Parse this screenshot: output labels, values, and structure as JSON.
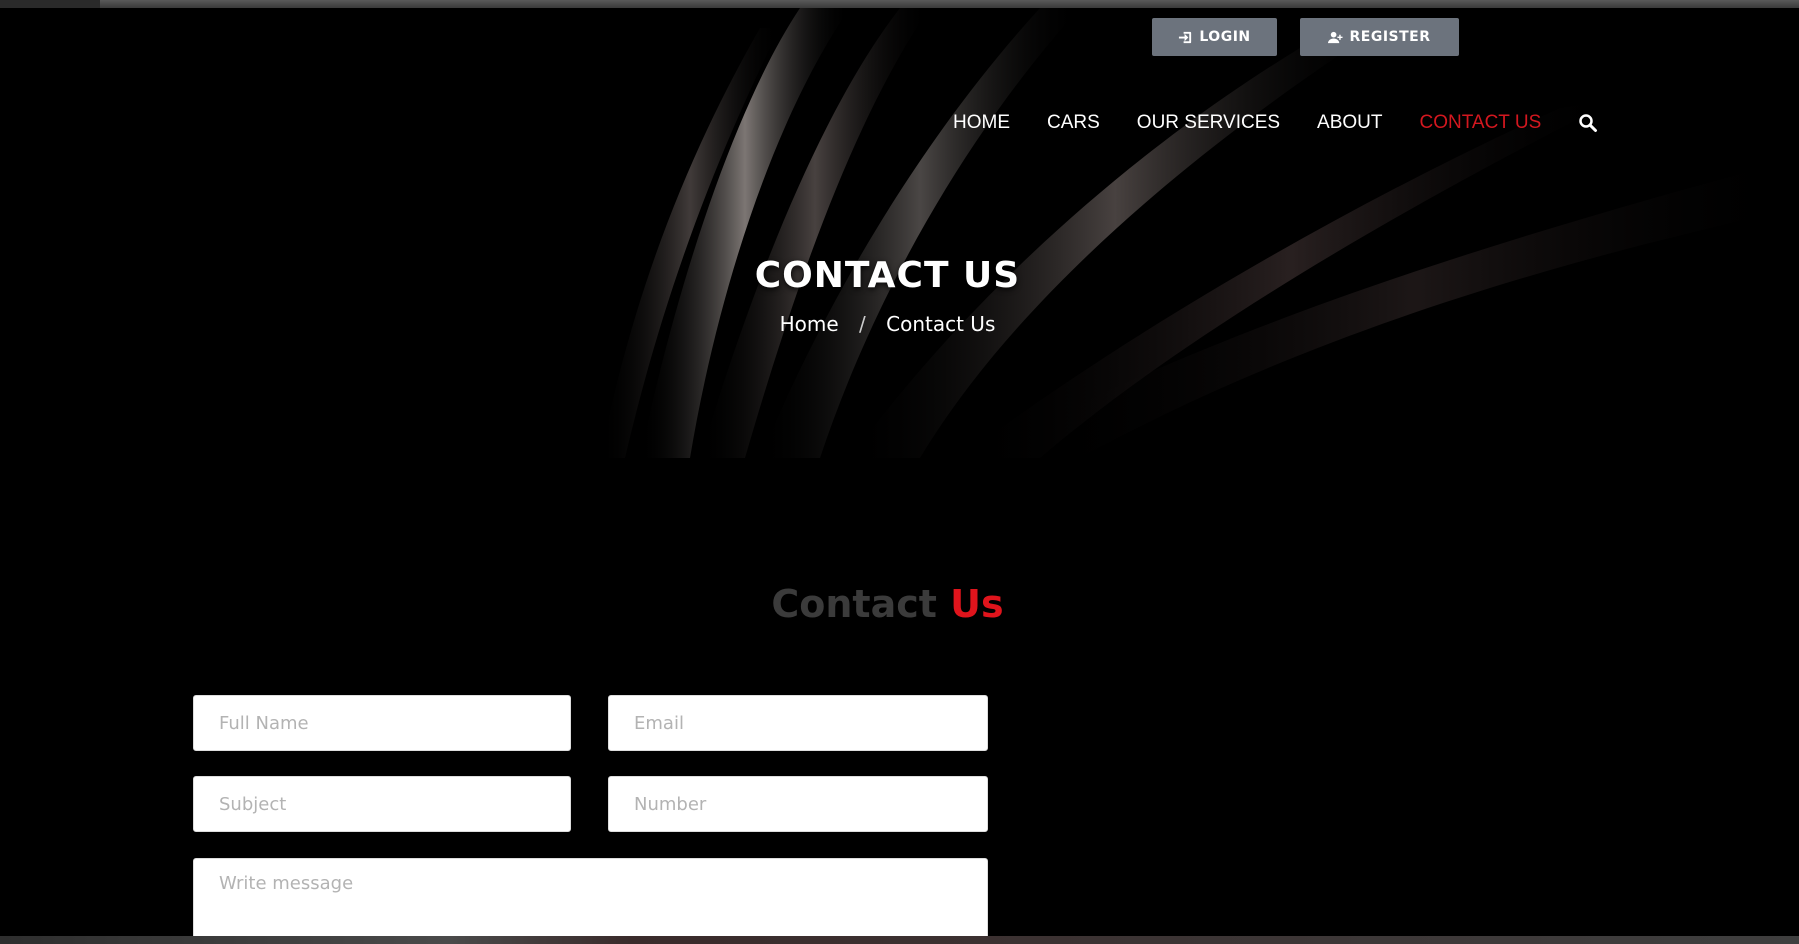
{
  "auth": {
    "login_label": "LOGIN",
    "register_label": "REGISTER"
  },
  "nav": {
    "items": [
      {
        "label": "HOME"
      },
      {
        "label": "CARS"
      },
      {
        "label": "OUR SERVICES"
      },
      {
        "label": "ABOUT"
      },
      {
        "label": "CONTACT US",
        "active": true
      }
    ],
    "search_icon": "search-icon"
  },
  "hero": {
    "title": "CONTACT US",
    "breadcrumb": {
      "home": "Home",
      "separator": "/",
      "current": "Contact Us"
    }
  },
  "contact": {
    "title_part1": "Contact",
    "title_part2": "Us",
    "fields": {
      "full_name_placeholder": "Full Name",
      "email_placeholder": "Email",
      "subject_placeholder": "Subject",
      "number_placeholder": "Number",
      "message_placeholder": "Write message"
    }
  },
  "colors": {
    "accent": "#e0141c",
    "button_bg": "#6c737d",
    "background": "#000000"
  }
}
